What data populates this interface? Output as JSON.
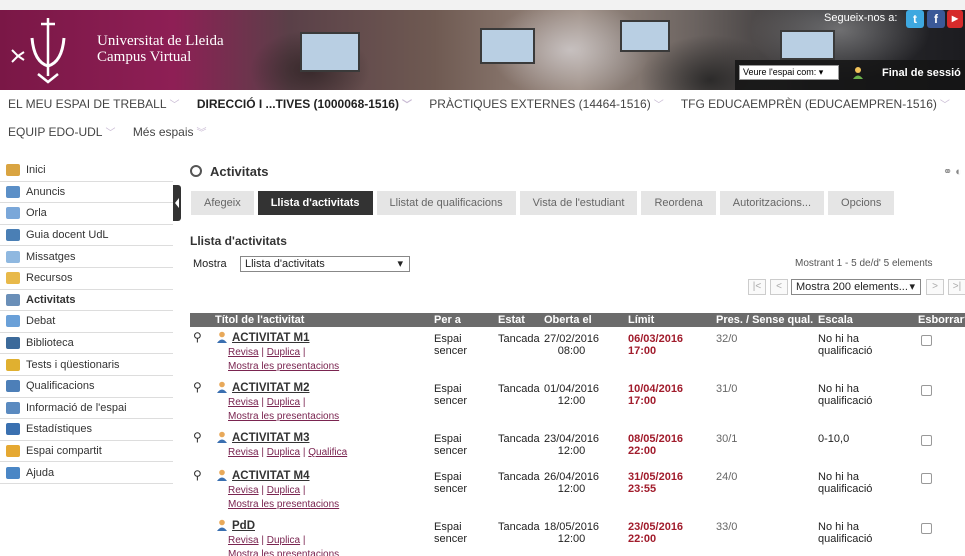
{
  "header": {
    "uni_line1": "Universitat de Lleida",
    "uni_line2": "Campus Virtual",
    "follow_label": "Segueix-nos a:",
    "space_select": "Veure l'espai com:",
    "logout": "Final de sessió"
  },
  "nav": {
    "row1": [
      {
        "label": "EL MEU ESPAI DE TREBALL",
        "bold": false
      },
      {
        "label": "DIRECCIÓ I ...TIVES (1000068-1516)",
        "bold": true
      },
      {
        "label": "PRÀCTIQUES EXTERNES (14464-1516)",
        "bold": false
      },
      {
        "label": "TFG EDUCAEMPRÈN (EDUCAEMPREN-1516)",
        "bold": false
      }
    ],
    "row2": [
      {
        "label": "EQUIP EDO-UDL"
      },
      {
        "label": "Més espais"
      }
    ]
  },
  "sidebar": {
    "items": [
      {
        "label": "Inici",
        "color": "#d9a441"
      },
      {
        "label": "Anuncis",
        "color": "#5b8fc7"
      },
      {
        "label": "Orla",
        "color": "#7aa7d9"
      },
      {
        "label": "Guia docent UdL",
        "color": "#4a7fb5"
      },
      {
        "label": "Missatges",
        "color": "#8fb8e0"
      },
      {
        "label": "Recursos",
        "color": "#e8b94a"
      },
      {
        "label": "Activitats",
        "color": "#6a8fb8",
        "active": true
      },
      {
        "label": "Debat",
        "color": "#6aa0d8"
      },
      {
        "label": "Biblioteca",
        "color": "#3c6a9a"
      },
      {
        "label": "Tests i qüestionaris",
        "color": "#e0b030"
      },
      {
        "label": "Qualificacions",
        "color": "#4d7fb8"
      },
      {
        "label": "Informació de l'espai",
        "color": "#5a8ac0"
      },
      {
        "label": "Estadístiques",
        "color": "#3a70b0"
      },
      {
        "label": "Espai compartit",
        "color": "#e5a832"
      },
      {
        "label": "Ajuda",
        "color": "#4a86c5"
      }
    ]
  },
  "main": {
    "title": "Activitats",
    "tabs": [
      {
        "label": "Afegeix"
      },
      {
        "label": "Llista d'activitats",
        "active": true
      },
      {
        "label": "Llistat de qualificacions"
      },
      {
        "label": "Vista de l'estudiant"
      },
      {
        "label": "Reordena"
      },
      {
        "label": "Autoritzacions..."
      },
      {
        "label": "Opcions"
      }
    ],
    "subtitle": "Llista d'activitats",
    "mostra_label": "Mostra",
    "mostra_value": "Llista d'activitats",
    "mostrant": "Mostrant 1 - 5 de/d' 5 elements",
    "pager_select": "Mostra 200 elements..."
  },
  "table": {
    "headers": [
      "Títol de l'activitat",
      "Per a",
      "Estat",
      "Oberta el",
      "Límit",
      "Pres. / Sense qual.",
      "Escala",
      "Esborrar?"
    ],
    "rows": [
      {
        "title": "ACTIVITAT M1",
        "links": [
          "Revisa",
          "Duplica",
          "Mostra les presentacions"
        ],
        "per_a": [
          "Espai",
          "sencer"
        ],
        "estat": "Tancada",
        "oberta": [
          "27/02/2016",
          "08:00"
        ],
        "limit": [
          "06/03/2016",
          "17:00"
        ],
        "pres": "32/0",
        "escala": [
          "No hi ha",
          "qualificació"
        ],
        "clip": true
      },
      {
        "title": "ACTIVITAT M2",
        "links": [
          "Revisa",
          "Duplica",
          "Mostra les presentacions"
        ],
        "per_a": [
          "Espai",
          "sencer"
        ],
        "estat": "Tancada",
        "oberta": [
          "01/04/2016",
          "12:00"
        ],
        "limit": [
          "10/04/2016",
          "17:00"
        ],
        "pres": "31/0",
        "escala": [
          "No hi ha",
          "qualificació"
        ],
        "clip": true
      },
      {
        "title": "ACTIVITAT M3",
        "links": [
          "Revisa",
          "Duplica",
          "Qualifica"
        ],
        "per_a": [
          "Espai",
          "sencer"
        ],
        "estat": "Tancada",
        "oberta": [
          "23/04/2016",
          "12:00"
        ],
        "limit": [
          "08/05/2016",
          "22:00"
        ],
        "pres": "30/1",
        "escala": [
          "0-10,0",
          ""
        ],
        "clip": true
      },
      {
        "title": "ACTIVITAT M4",
        "links": [
          "Revisa",
          "Duplica",
          "Mostra les presentacions"
        ],
        "per_a": [
          "Espai",
          "sencer"
        ],
        "estat": "Tancada",
        "oberta": [
          "26/04/2016",
          "12:00"
        ],
        "limit": [
          "31/05/2016",
          "23:55"
        ],
        "pres": "24/0",
        "escala": [
          "No hi ha",
          "qualificació"
        ],
        "clip": true
      },
      {
        "title": "PdD",
        "links": [
          "Revisa",
          "Duplica",
          "Mostra les presentacions"
        ],
        "per_a": [
          "Espai",
          "sencer"
        ],
        "estat": "Tancada",
        "oberta": [
          "18/05/2016",
          "12:00"
        ],
        "limit": [
          "23/05/2016",
          "22:00"
        ],
        "pres": "33/0",
        "escala": [
          "No hi ha",
          "qualificació"
        ],
        "clip": false
      }
    ]
  }
}
